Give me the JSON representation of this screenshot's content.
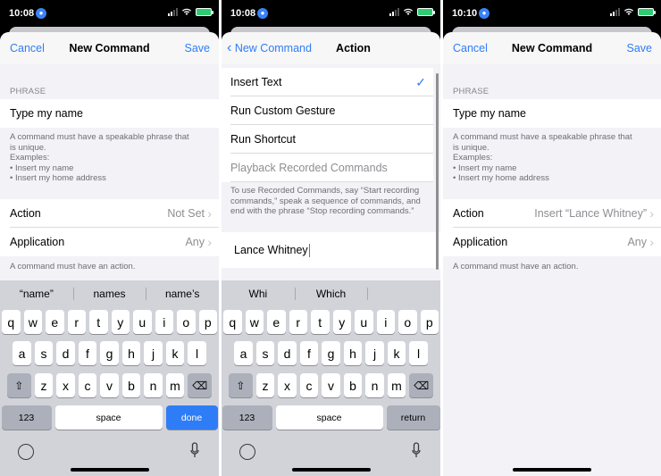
{
  "colors": {
    "accent": "#2f7df6",
    "battery": "#2ecc71",
    "keyboard_bg": "#d1d3d9"
  },
  "screens": [
    {
      "status": {
        "time": "10:08"
      },
      "nav": {
        "left": "Cancel",
        "title": "New Command",
        "right": "Save"
      },
      "phrase_label": "PHRASE",
      "phrase_value": "Type my name",
      "phrase_help": [
        "A command must have a speakable phrase that",
        "is unique.",
        "Examples:",
        "• Insert my name",
        "• Insert my home address"
      ],
      "action_label": "Action",
      "action_value": "Not Set",
      "application_label": "Application",
      "application_value": "Any",
      "footer": "A command must have an action.",
      "suggestions": [
        "“name”",
        "names",
        "name’s"
      ],
      "keys": {
        "row1": [
          "q",
          "w",
          "e",
          "r",
          "t",
          "y",
          "u",
          "i",
          "o",
          "p"
        ],
        "row2": [
          "a",
          "s",
          "d",
          "f",
          "g",
          "h",
          "j",
          "k",
          "l"
        ],
        "row3": [
          "z",
          "x",
          "c",
          "v",
          "b",
          "n",
          "m"
        ],
        "num": "123",
        "space": "space",
        "action": "done"
      }
    },
    {
      "status": {
        "time": "10:08"
      },
      "nav": {
        "left": "New Command",
        "title": "Action"
      },
      "options": [
        {
          "label": "Insert Text",
          "checked": true
        },
        {
          "label": "Run Custom Gesture"
        },
        {
          "label": "Run Shortcut"
        },
        {
          "label": "Playback Recorded Commands"
        }
      ],
      "recorded_help": [
        "To use Recorded Commands, say “Start recording",
        "commands,” speak a sequence of commands, and",
        "end with the phrase “Stop recording commands.”"
      ],
      "text_value": "Lance Whitney",
      "suggestions": [
        "Whi",
        "Which",
        ""
      ],
      "keys": {
        "row1": [
          "q",
          "w",
          "e",
          "r",
          "t",
          "y",
          "u",
          "i",
          "o",
          "p"
        ],
        "row2": [
          "a",
          "s",
          "d",
          "f",
          "g",
          "h",
          "j",
          "k",
          "l"
        ],
        "row3": [
          "z",
          "x",
          "c",
          "v",
          "b",
          "n",
          "m"
        ],
        "num": "123",
        "space": "space",
        "action": "return"
      }
    },
    {
      "status": {
        "time": "10:10"
      },
      "nav": {
        "left": "Cancel",
        "title": "New Command",
        "right": "Save"
      },
      "phrase_label": "PHRASE",
      "phrase_value": "Type my name",
      "phrase_help": [
        "A command must have a speakable phrase that",
        "is unique.",
        "Examples:",
        "• Insert my name",
        "• Insert my home address"
      ],
      "action_label": "Action",
      "action_value": "Insert “Lance Whitney”",
      "application_label": "Application",
      "application_value": "Any",
      "footer": "A command must have an action."
    }
  ]
}
